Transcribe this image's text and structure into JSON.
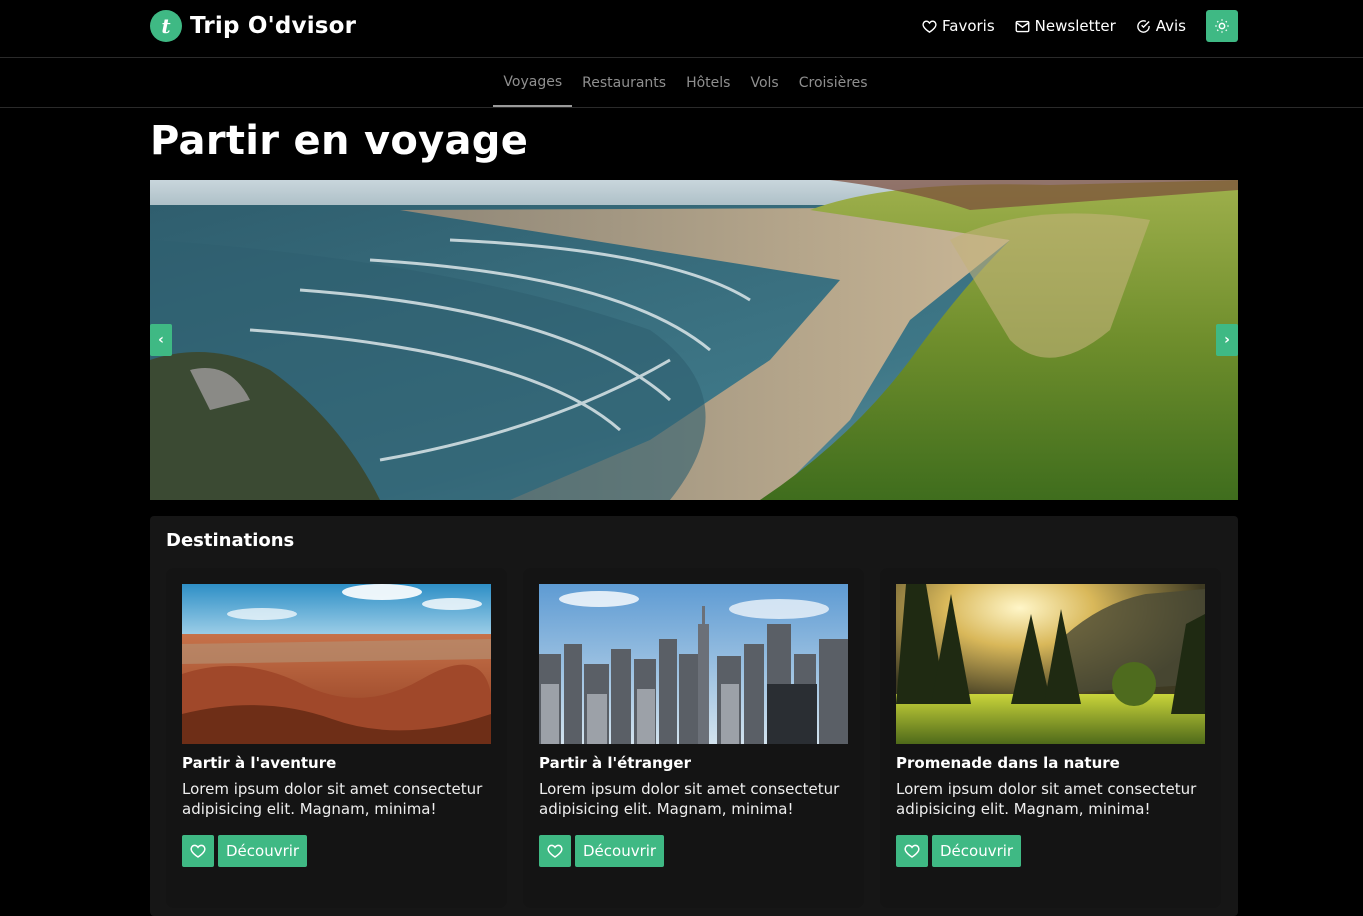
{
  "header": {
    "logo_letter": "t",
    "brand": "Trip O'dvisor",
    "nav": [
      {
        "label": "Favoris",
        "icon": "heart-icon"
      },
      {
        "label": "Newsletter",
        "icon": "envelope-icon"
      },
      {
        "label": "Avis",
        "icon": "check-circle-icon"
      }
    ],
    "theme_icon": "sun-icon",
    "accent": "#3fb984"
  },
  "subnav": {
    "tabs": [
      "Voyages",
      "Restaurants",
      "Hôtels",
      "Vols",
      "Croisières"
    ],
    "active": "Voyages"
  },
  "page": {
    "title": "Partir en voyage"
  },
  "hero": {
    "prev_label": "‹",
    "next_label": "›",
    "image": "coastline-beach-photo"
  },
  "destinations": {
    "title": "Destinations",
    "cards": [
      {
        "title": "Partir à l'aventure",
        "desc": "Lorem ipsum dolor sit amet consectetur adipisicing elit. Magnam, minima!",
        "button": "Découvrir",
        "image": "canyon-desert-photo"
      },
      {
        "title": "Partir à l'étranger",
        "desc": "Lorem ipsum dolor sit amet consectetur adipisicing elit. Magnam, minima!",
        "button": "Découvrir",
        "image": "city-skyline-photo"
      },
      {
        "title": "Promenade dans la nature",
        "desc": "Lorem ipsum dolor sit amet consectetur adipisicing elit. Magnam, minima!",
        "button": "Découvrir",
        "image": "forest-sunlight-photo"
      }
    ]
  }
}
